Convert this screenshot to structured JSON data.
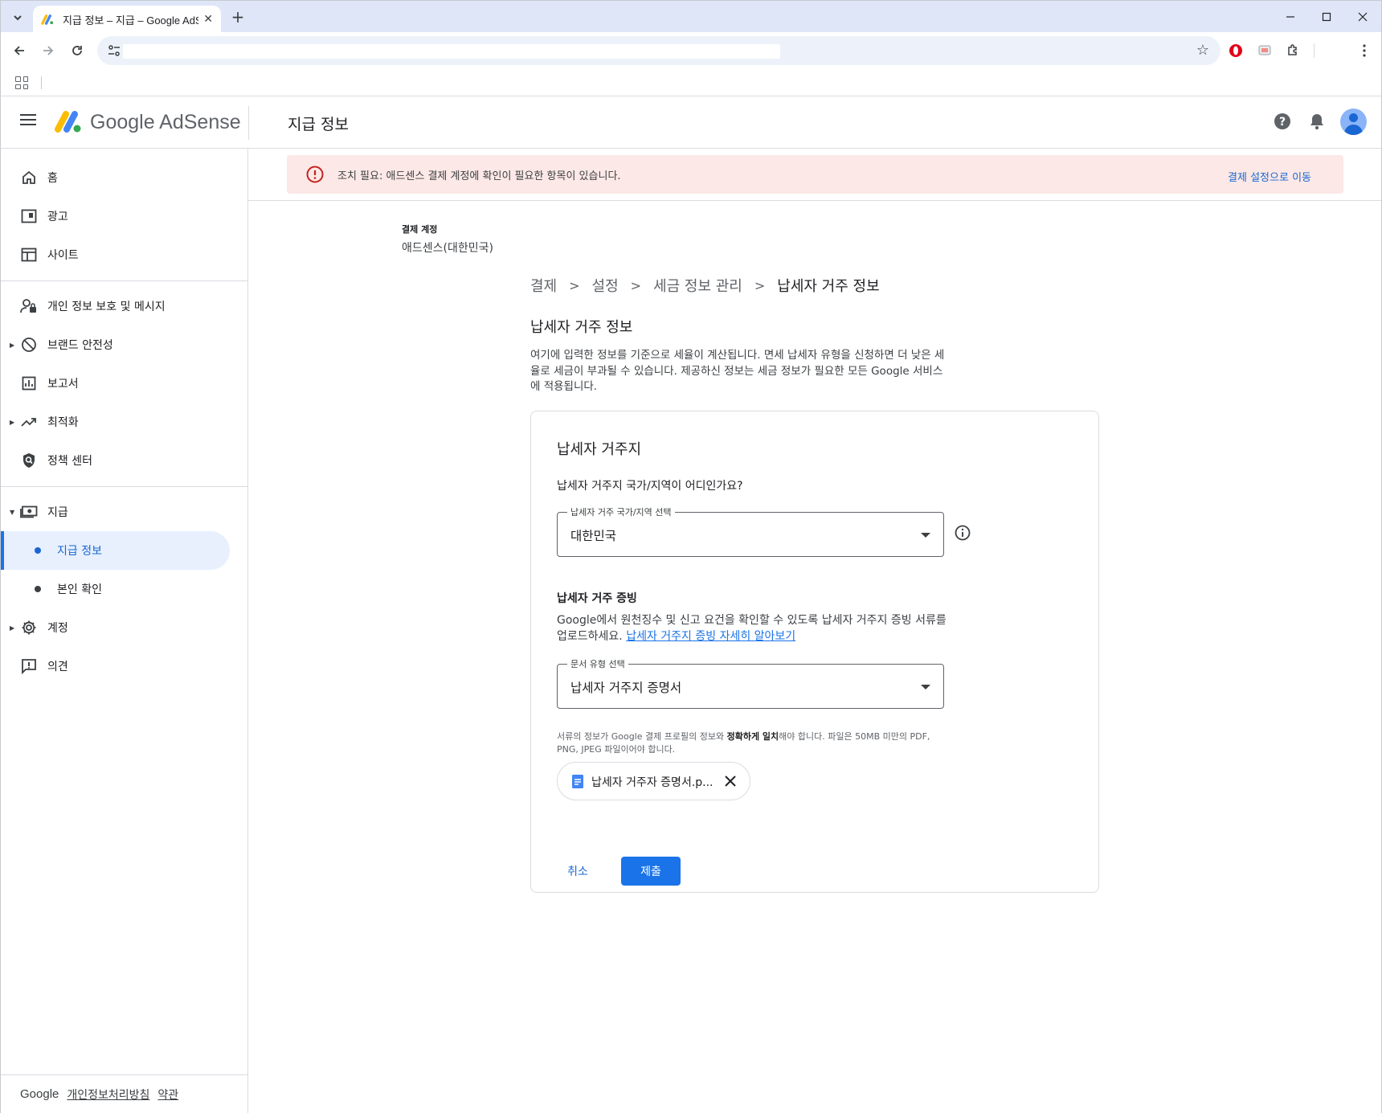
{
  "browser": {
    "tab_title": "지급 정보 – 지급 – Google AdSense",
    "tab_close": "✕",
    "new_tab": "+",
    "minimize": "—",
    "maximize": "☐",
    "close": "✕"
  },
  "header": {
    "logo_text": "Google AdSense",
    "page_title": "지급 정보"
  },
  "sidebar": {
    "items": [
      {
        "label": "홈",
        "icon": "home-icon"
      },
      {
        "label": "광고",
        "icon": "ads-icon"
      },
      {
        "label": "사이트",
        "icon": "sites-icon"
      },
      {
        "label": "개인 정보 보호 및 메시지",
        "icon": "privacy-icon"
      },
      {
        "label": "브랜드 안전성",
        "icon": "block-icon"
      },
      {
        "label": "보고서",
        "icon": "reports-icon"
      },
      {
        "label": "최적화",
        "icon": "trending-icon"
      },
      {
        "label": "정책 센터",
        "icon": "policy-icon"
      },
      {
        "label": "지급",
        "icon": "payments-icon"
      },
      {
        "label": "지급 정보"
      },
      {
        "label": "본인 확인"
      },
      {
        "label": "계정",
        "icon": "settings-icon"
      },
      {
        "label": "의견",
        "icon": "feedback-icon"
      }
    ],
    "footer": {
      "google": "Google",
      "privacy": "개인정보처리방침",
      "terms": "약관"
    }
  },
  "alert": {
    "message": "조치 필요: 애드센스 결제 계정에 확인이 필요한 항목이 있습니다.",
    "action": "결제 설정으로 이동"
  },
  "account": {
    "label": "결제 계정",
    "value": "애드센스(대한민국)"
  },
  "breadcrumb": [
    "결제",
    "설정",
    "세금 정보 관리",
    "납세자 거주 정보"
  ],
  "section": {
    "title": "납세자 거주 정보",
    "description": "여기에 입력한 정보를 기준으로 세율이 계산됩니다. 면세 납세자 유형을 신청하면 더 낮은 세율로 세금이 부과될 수 있습니다. 제공하신 정보는 세금 정보가 필요한 모든 Google 서비스에 적용됩니다."
  },
  "card": {
    "title": "납세자 거주지",
    "question": "납세자 거주지 국가/지역이 어디인가요?",
    "country_select": {
      "label": "납세자 거주 국가/지역 선택",
      "value": "대한민국"
    },
    "proof_title": "납세자 거주 증빙",
    "proof_desc": "Google에서 원천징수 및 신고 요건을 확인할 수 있도록 납세자 거주지 증빙 서류를 업로드하세요. ",
    "proof_link": "납세자 거주지 증빙 자세히 알아보기",
    "doc_select": {
      "label": "문서 유형 선택",
      "value": "납세자 거주지 증명서"
    },
    "hint_a": "서류의 정보가 Google 결제 프로필의 정보와 ",
    "hint_bold": "정확하게 일치",
    "hint_b": "해야 합니다. 파일은 50MB 미만의 PDF, PNG, JPEG 파일이어야 합니다.",
    "file_name": "납세자 거주자 증명서.p...",
    "cancel": "취소",
    "submit": "제출"
  }
}
